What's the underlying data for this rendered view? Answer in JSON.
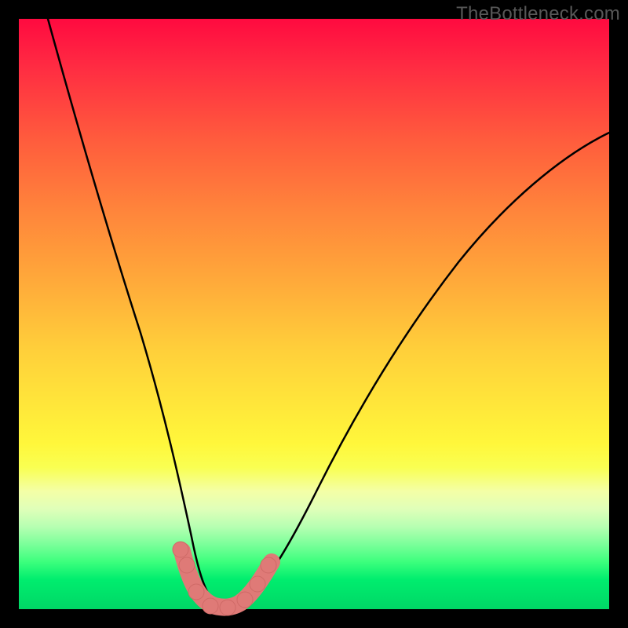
{
  "watermark": "TheBottleneck.com",
  "colors": {
    "frame": "#000000",
    "curve": "#000000",
    "marker": "#df7a77",
    "gradient_top": "#ff0a40",
    "gradient_bottom": "#00d766"
  },
  "chart_data": {
    "type": "line",
    "title": "",
    "xlabel": "",
    "ylabel": "",
    "xlim": [
      0,
      100
    ],
    "ylim": [
      0,
      100
    ],
    "description": "V-shaped bottleneck curve on rainbow gradient background; minimum near x≈33.",
    "series": [
      {
        "name": "bottleneck-curve",
        "x": [
          5,
          10,
          15,
          20,
          25,
          28,
          30,
          32,
          34,
          36,
          40,
          50,
          60,
          70,
          80,
          90,
          100
        ],
        "y": [
          100,
          80,
          58,
          38,
          18,
          8,
          3,
          0,
          0,
          2,
          7,
          22,
          36,
          48,
          58,
          66,
          73
        ]
      }
    ],
    "markers": {
      "name": "highlight-dots",
      "x": [
        27.5,
        28.5,
        30,
        32,
        34,
        35.5,
        37,
        38
      ],
      "y": [
        9,
        7,
        2,
        0,
        0,
        2,
        5,
        8
      ]
    }
  }
}
